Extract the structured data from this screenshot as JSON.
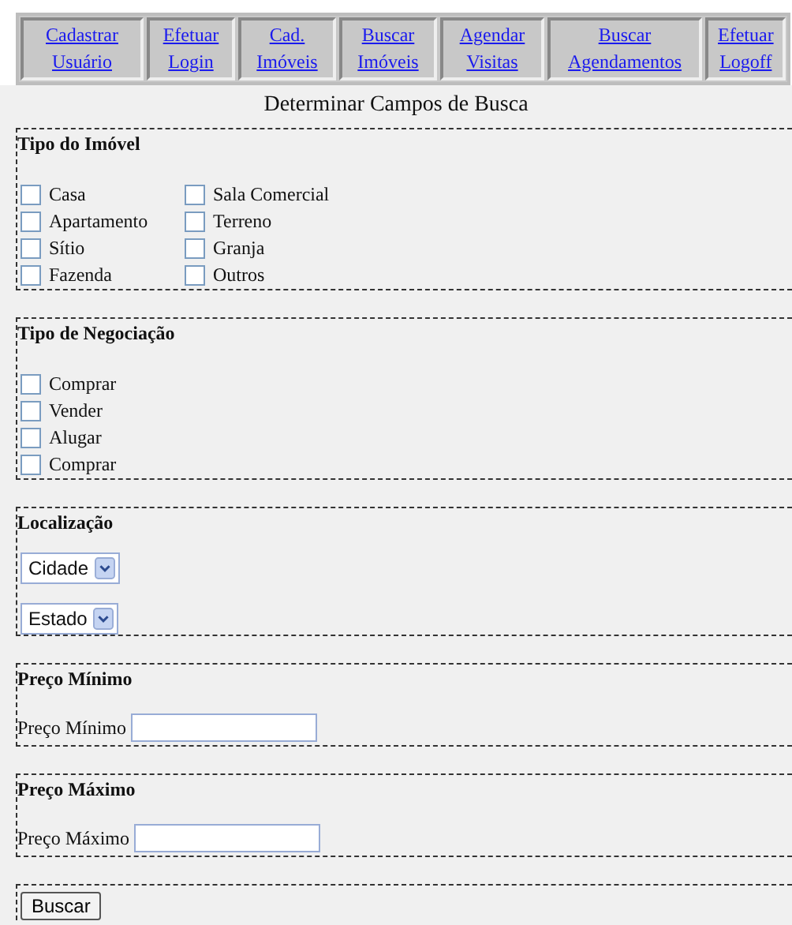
{
  "nav": [
    {
      "lines": [
        "Cadastrar",
        "Usuário"
      ]
    },
    {
      "lines": [
        "Efetuar",
        "Login"
      ]
    },
    {
      "lines": [
        "Cad.",
        "Imóveis"
      ]
    },
    {
      "lines": [
        "Buscar",
        "Imóveis"
      ]
    },
    {
      "lines": [
        "Agendar",
        "Visitas"
      ]
    },
    {
      "lines": [
        "Buscar",
        "Agendamentos"
      ]
    },
    {
      "lines": [
        "Efetuar",
        "Logoff"
      ]
    }
  ],
  "title": "Determinar Campos de Busca",
  "property_type": {
    "heading": "Tipo do Imóvel",
    "columns": [
      [
        {
          "label": "Casa",
          "checked": false
        },
        {
          "label": "Apartamento",
          "checked": false
        },
        {
          "label": "Sítio",
          "checked": false
        },
        {
          "label": "Fazenda",
          "checked": false
        }
      ],
      [
        {
          "label": "Sala Comercial",
          "checked": false
        },
        {
          "label": "Terreno",
          "checked": false
        },
        {
          "label": "Granja",
          "checked": false
        },
        {
          "label": "Outros",
          "checked": false
        }
      ]
    ]
  },
  "negotiation_type": {
    "heading": "Tipo de Negociação",
    "options": [
      {
        "label": "Comprar",
        "checked": false
      },
      {
        "label": "Vender",
        "checked": false
      },
      {
        "label": "Alugar",
        "checked": false
      },
      {
        "label": "Comprar",
        "checked": false
      }
    ]
  },
  "location": {
    "heading": "Localização",
    "selects": [
      {
        "value": "Cidade"
      },
      {
        "value": "Estado"
      }
    ]
  },
  "min_price": {
    "heading": "Preço Mínimo",
    "label": "Preço Mínimo"
  },
  "max_price": {
    "heading": "Preço Máximo",
    "label": "Preço Máximo"
  },
  "submit": "Buscar"
}
